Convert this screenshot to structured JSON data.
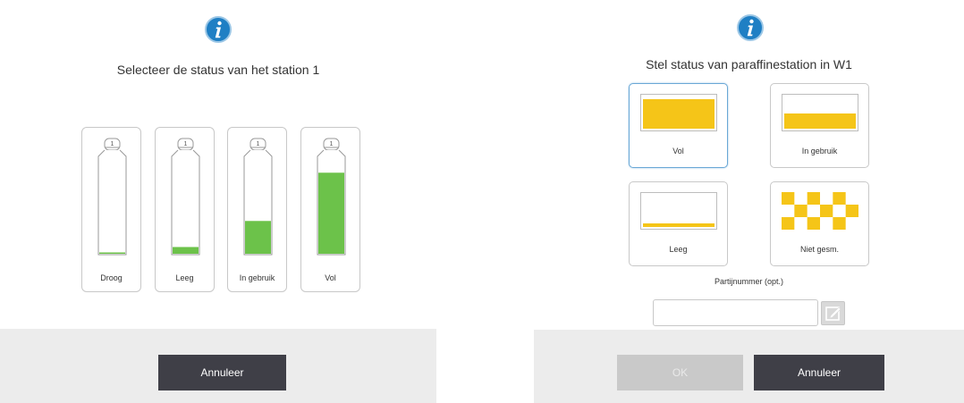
{
  "left_dialog": {
    "title": "Selecteer de status van het station 1",
    "bottles": [
      {
        "label": "Droog",
        "number": "1",
        "fill_fraction": 0.0
      },
      {
        "label": "Leeg",
        "number": "1",
        "fill_fraction": 0.07
      },
      {
        "label": "In gebruik",
        "number": "1",
        "fill_fraction": 0.34
      },
      {
        "label": "Vol",
        "number": "1",
        "fill_fraction": 0.84
      }
    ],
    "cancel_label": "Annuleer"
  },
  "right_dialog": {
    "title": "Stel status van paraffinestation in W1",
    "options": [
      {
        "label": "Vol",
        "state": "full",
        "selected": true
      },
      {
        "label": "In gebruik",
        "state": "in-use",
        "selected": false
      },
      {
        "label": "Leeg",
        "state": "empty",
        "selected": false
      },
      {
        "label": "Niet gesm.",
        "state": "not-melted",
        "selected": false
      }
    ],
    "batch_label": "Partijnummer (opt.)",
    "batch_value": "",
    "ok_label": "OK",
    "cancel_label": "Annuleer"
  },
  "colors": {
    "info_blue": "#1f7fc4",
    "bottle_green": "#6cc24a",
    "paraffin_yellow": "#f5c518",
    "selected_border": "#6aa8d6",
    "dark_button": "#3f3f47",
    "footer_bg": "#ececec"
  },
  "icons": {
    "info": "info-icon",
    "edit": "pencil-edit-icon"
  }
}
